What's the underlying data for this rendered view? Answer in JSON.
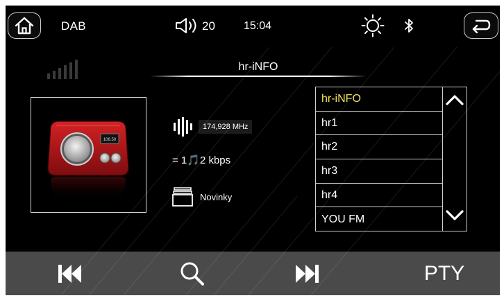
{
  "status_bar": {
    "source": "DAB",
    "volume": "20",
    "time": "15:04",
    "icons": [
      "home-icon",
      "volume-icon",
      "brightness-icon",
      "bluetooth-icon",
      "back-icon"
    ]
  },
  "radio": {
    "station_title": "hr-iNFO",
    "frequency": "174,928 MHz",
    "bitrate": "= 1🎵2 kbps",
    "pty": "Novinky",
    "signal_bars": 5,
    "radio_display": "106.50"
  },
  "station_list": {
    "items": [
      {
        "label": "hr-iNFO",
        "active": true
      },
      {
        "label": "hr1",
        "active": false
      },
      {
        "label": "hr2",
        "active": false
      },
      {
        "label": "hr3",
        "active": false
      },
      {
        "label": "hr4",
        "active": false
      },
      {
        "label": "YOU FM",
        "active": false
      }
    ]
  },
  "bottom_bar": {
    "pty_label": "PTY"
  },
  "colors": {
    "active_station": "#f2e15a",
    "bottom_bar": "#4a4a4a",
    "radio_body": "#b3161a"
  }
}
